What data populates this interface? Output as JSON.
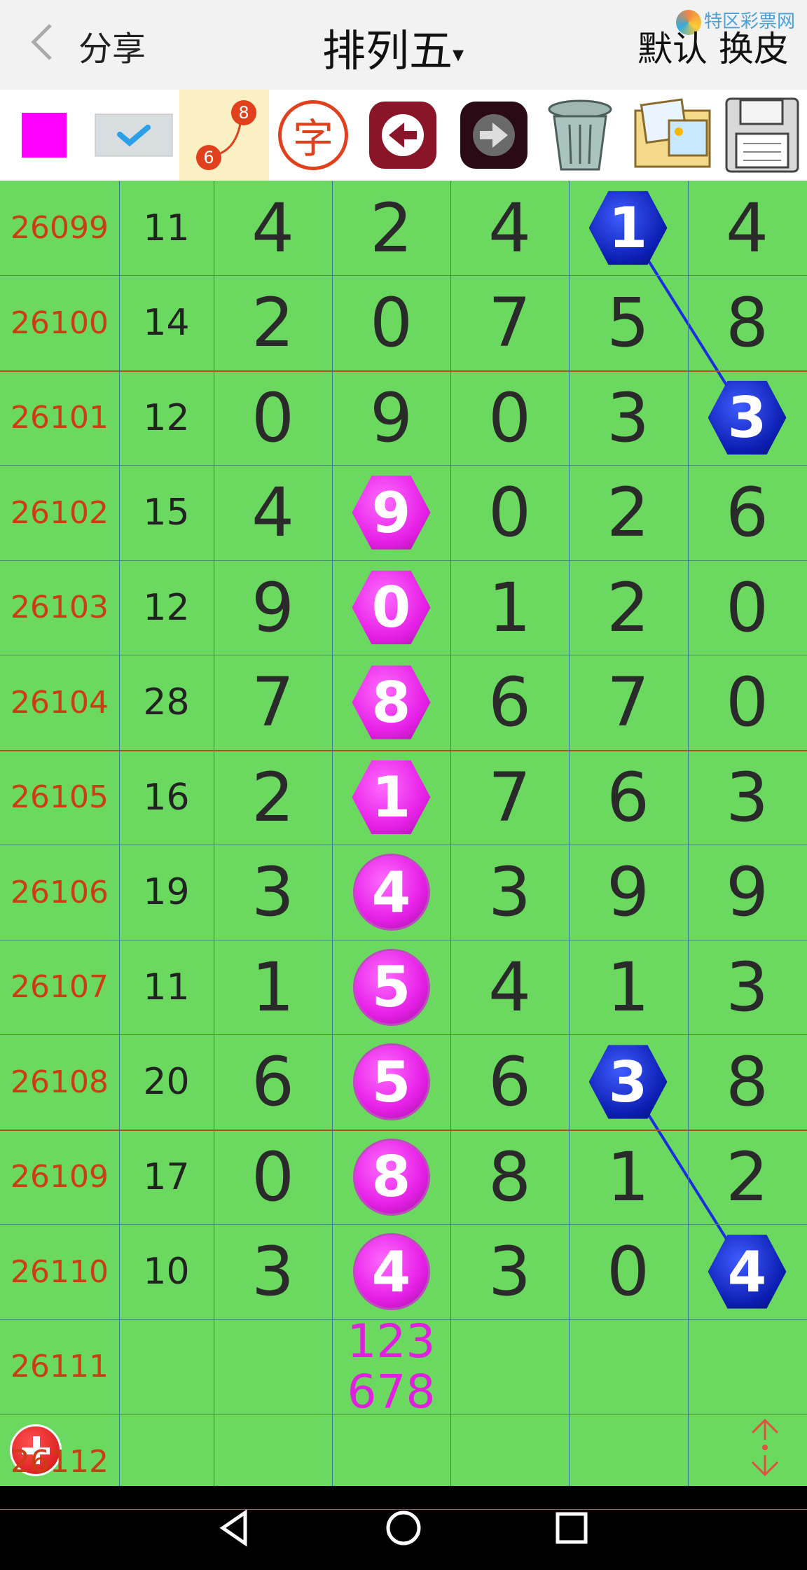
{
  "header": {
    "back_icon": "chevron-left-icon",
    "share_label": "分享",
    "title": "排列五",
    "title_caret": "▾",
    "skin_label": "默认 换皮",
    "watermark": "特区彩票网"
  },
  "toolbar": {
    "items": [
      {
        "name": "magenta-swatch",
        "icon": "square-icon",
        "color": "#ff00ff"
      },
      {
        "name": "check-toggle",
        "icon": "check-icon"
      },
      {
        "name": "connect-line-tool",
        "icon": "connect-icon",
        "labels": [
          "8",
          "6"
        ]
      },
      {
        "name": "text-tool",
        "icon": "zi-icon",
        "label": "字"
      },
      {
        "name": "undo-button",
        "icon": "arrow-left-icon"
      },
      {
        "name": "redo-button",
        "icon": "arrow-right-icon"
      },
      {
        "name": "trash-button",
        "icon": "trash-icon"
      },
      {
        "name": "gallery-button",
        "icon": "photos-icon"
      },
      {
        "name": "save-button",
        "icon": "floppy-icon"
      }
    ]
  },
  "rows": [
    {
      "issue": "26099",
      "sum": "11",
      "digits": [
        "4",
        "2",
        "4",
        "1",
        "4"
      ],
      "sep": false
    },
    {
      "issue": "26100",
      "sum": "14",
      "digits": [
        "2",
        "0",
        "7",
        "5",
        "8"
      ],
      "sep": true
    },
    {
      "issue": "26101",
      "sum": "12",
      "digits": [
        "0",
        "9",
        "0",
        "3",
        "3"
      ],
      "sep": false
    },
    {
      "issue": "26102",
      "sum": "15",
      "digits": [
        "4",
        "9",
        "0",
        "2",
        "6"
      ],
      "sep": false
    },
    {
      "issue": "26103",
      "sum": "12",
      "digits": [
        "9",
        "0",
        "1",
        "2",
        "0"
      ],
      "sep": false
    },
    {
      "issue": "26104",
      "sum": "28",
      "digits": [
        "7",
        "8",
        "6",
        "7",
        "0"
      ],
      "sep": true
    },
    {
      "issue": "26105",
      "sum": "16",
      "digits": [
        "2",
        "1",
        "7",
        "6",
        "3"
      ],
      "sep": false
    },
    {
      "issue": "26106",
      "sum": "19",
      "digits": [
        "3",
        "4",
        "3",
        "9",
        "9"
      ],
      "sep": false
    },
    {
      "issue": "26107",
      "sum": "11",
      "digits": [
        "1",
        "5",
        "4",
        "1",
        "3"
      ],
      "sep": false
    },
    {
      "issue": "26108",
      "sum": "20",
      "digits": [
        "6",
        "5",
        "6",
        "3",
        "8"
      ],
      "sep": true
    },
    {
      "issue": "26109",
      "sum": "17",
      "digits": [
        "0",
        "8",
        "8",
        "1",
        "2"
      ],
      "sep": false
    },
    {
      "issue": "26110",
      "sum": "10",
      "digits": [
        "3",
        "4",
        "3",
        "0",
        "4"
      ],
      "sep": false
    },
    {
      "issue": "26111",
      "sum": "",
      "digits": [
        "",
        "",
        "",
        "",
        ""
      ],
      "sep": false,
      "prediction": [
        "123",
        "678"
      ]
    },
    {
      "issue": "26112",
      "sum": "",
      "digits": [
        "",
        "",
        "",
        "",
        ""
      ],
      "sep": false
    }
  ],
  "marks": [
    {
      "row": 0,
      "col": 3,
      "style": "hex-blue"
    },
    {
      "row": 2,
      "col": 4,
      "style": "hex-blue"
    },
    {
      "row": 3,
      "col": 1,
      "style": "hex-pink"
    },
    {
      "row": 4,
      "col": 1,
      "style": "hex-pink"
    },
    {
      "row": 5,
      "col": 1,
      "style": "hex-pink"
    },
    {
      "row": 6,
      "col": 1,
      "style": "hex-pink"
    },
    {
      "row": 7,
      "col": 1,
      "style": "circ-pink"
    },
    {
      "row": 8,
      "col": 1,
      "style": "circ-pink"
    },
    {
      "row": 9,
      "col": 1,
      "style": "circ-pink"
    },
    {
      "row": 10,
      "col": 1,
      "style": "circ-pink"
    },
    {
      "row": 11,
      "col": 1,
      "style": "circ-pink"
    },
    {
      "row": 9,
      "col": 3,
      "style": "hex-blue"
    },
    {
      "row": 11,
      "col": 4,
      "style": "hex-blue"
    }
  ],
  "connections": [
    {
      "from": [
        0,
        3
      ],
      "to": [
        2,
        4
      ]
    },
    {
      "from": [
        9,
        3
      ],
      "to": [
        11,
        4
      ]
    }
  ],
  "colors": {
    "grid_bg": "#6bd95f",
    "issue_text": "#cc3d13",
    "row_separator": "#b05020",
    "link_line": "#1a2ee0"
  },
  "fab": {
    "add_icon": "plus-icon",
    "scroll_icon": "updown-icon"
  },
  "navbar": {
    "icons": [
      "back-triangle-icon",
      "home-circle-icon",
      "recents-square-icon"
    ]
  }
}
